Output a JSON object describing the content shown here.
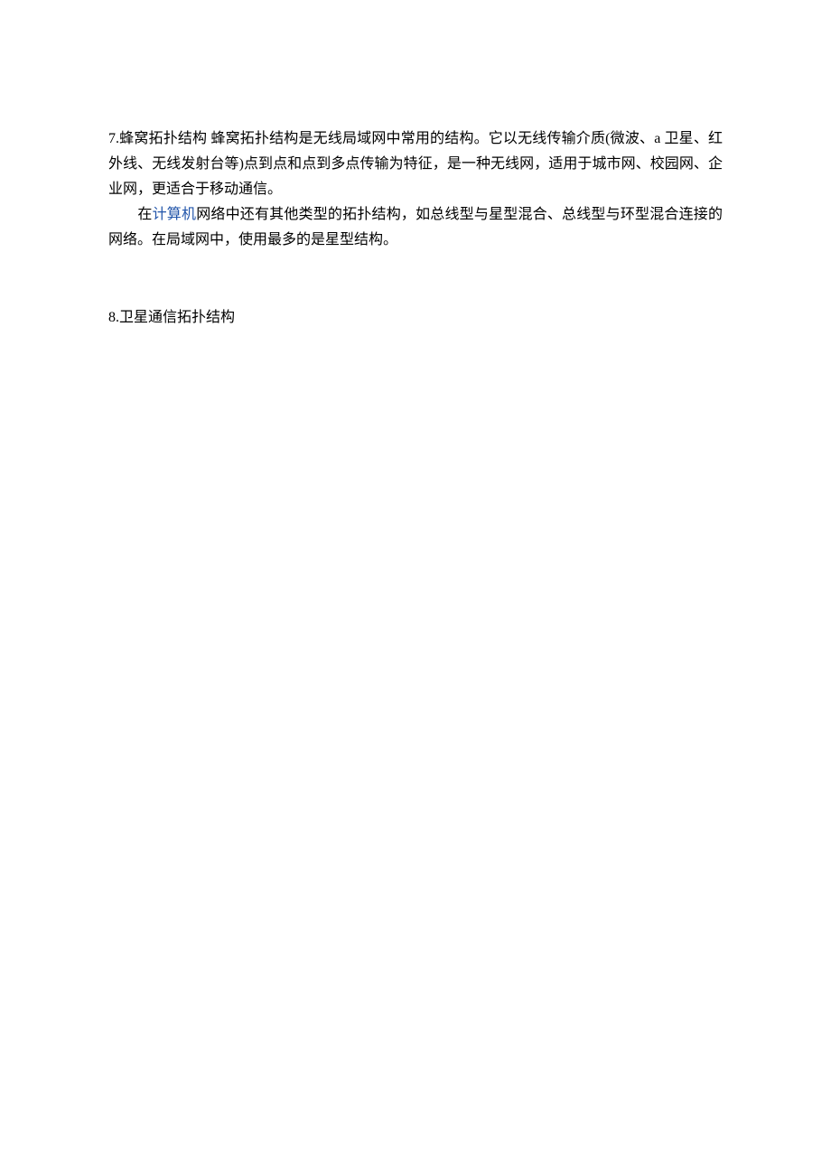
{
  "section7": {
    "para1": "7.蜂窝拓扑结构 蜂窝拓扑结构是无线局域网中常用的结构。它以无线传输介质(微波、a 卫星、红外线、无线发射台等)点到点和点到多点传输为特征，是一种无线网，适用于城市网、校园网、企业网，更适合于移动通信。",
    "para2_prefix": "　　在",
    "para2_link": "计算机",
    "para2_suffix": "网络中还有其他类型的拓扑结构，如总线型与星型混合、总线型与环型混合连接的网络。在局域网中，使用最多的是星型结构。"
  },
  "section8": {
    "heading": "8.卫星通信拓扑结构"
  }
}
